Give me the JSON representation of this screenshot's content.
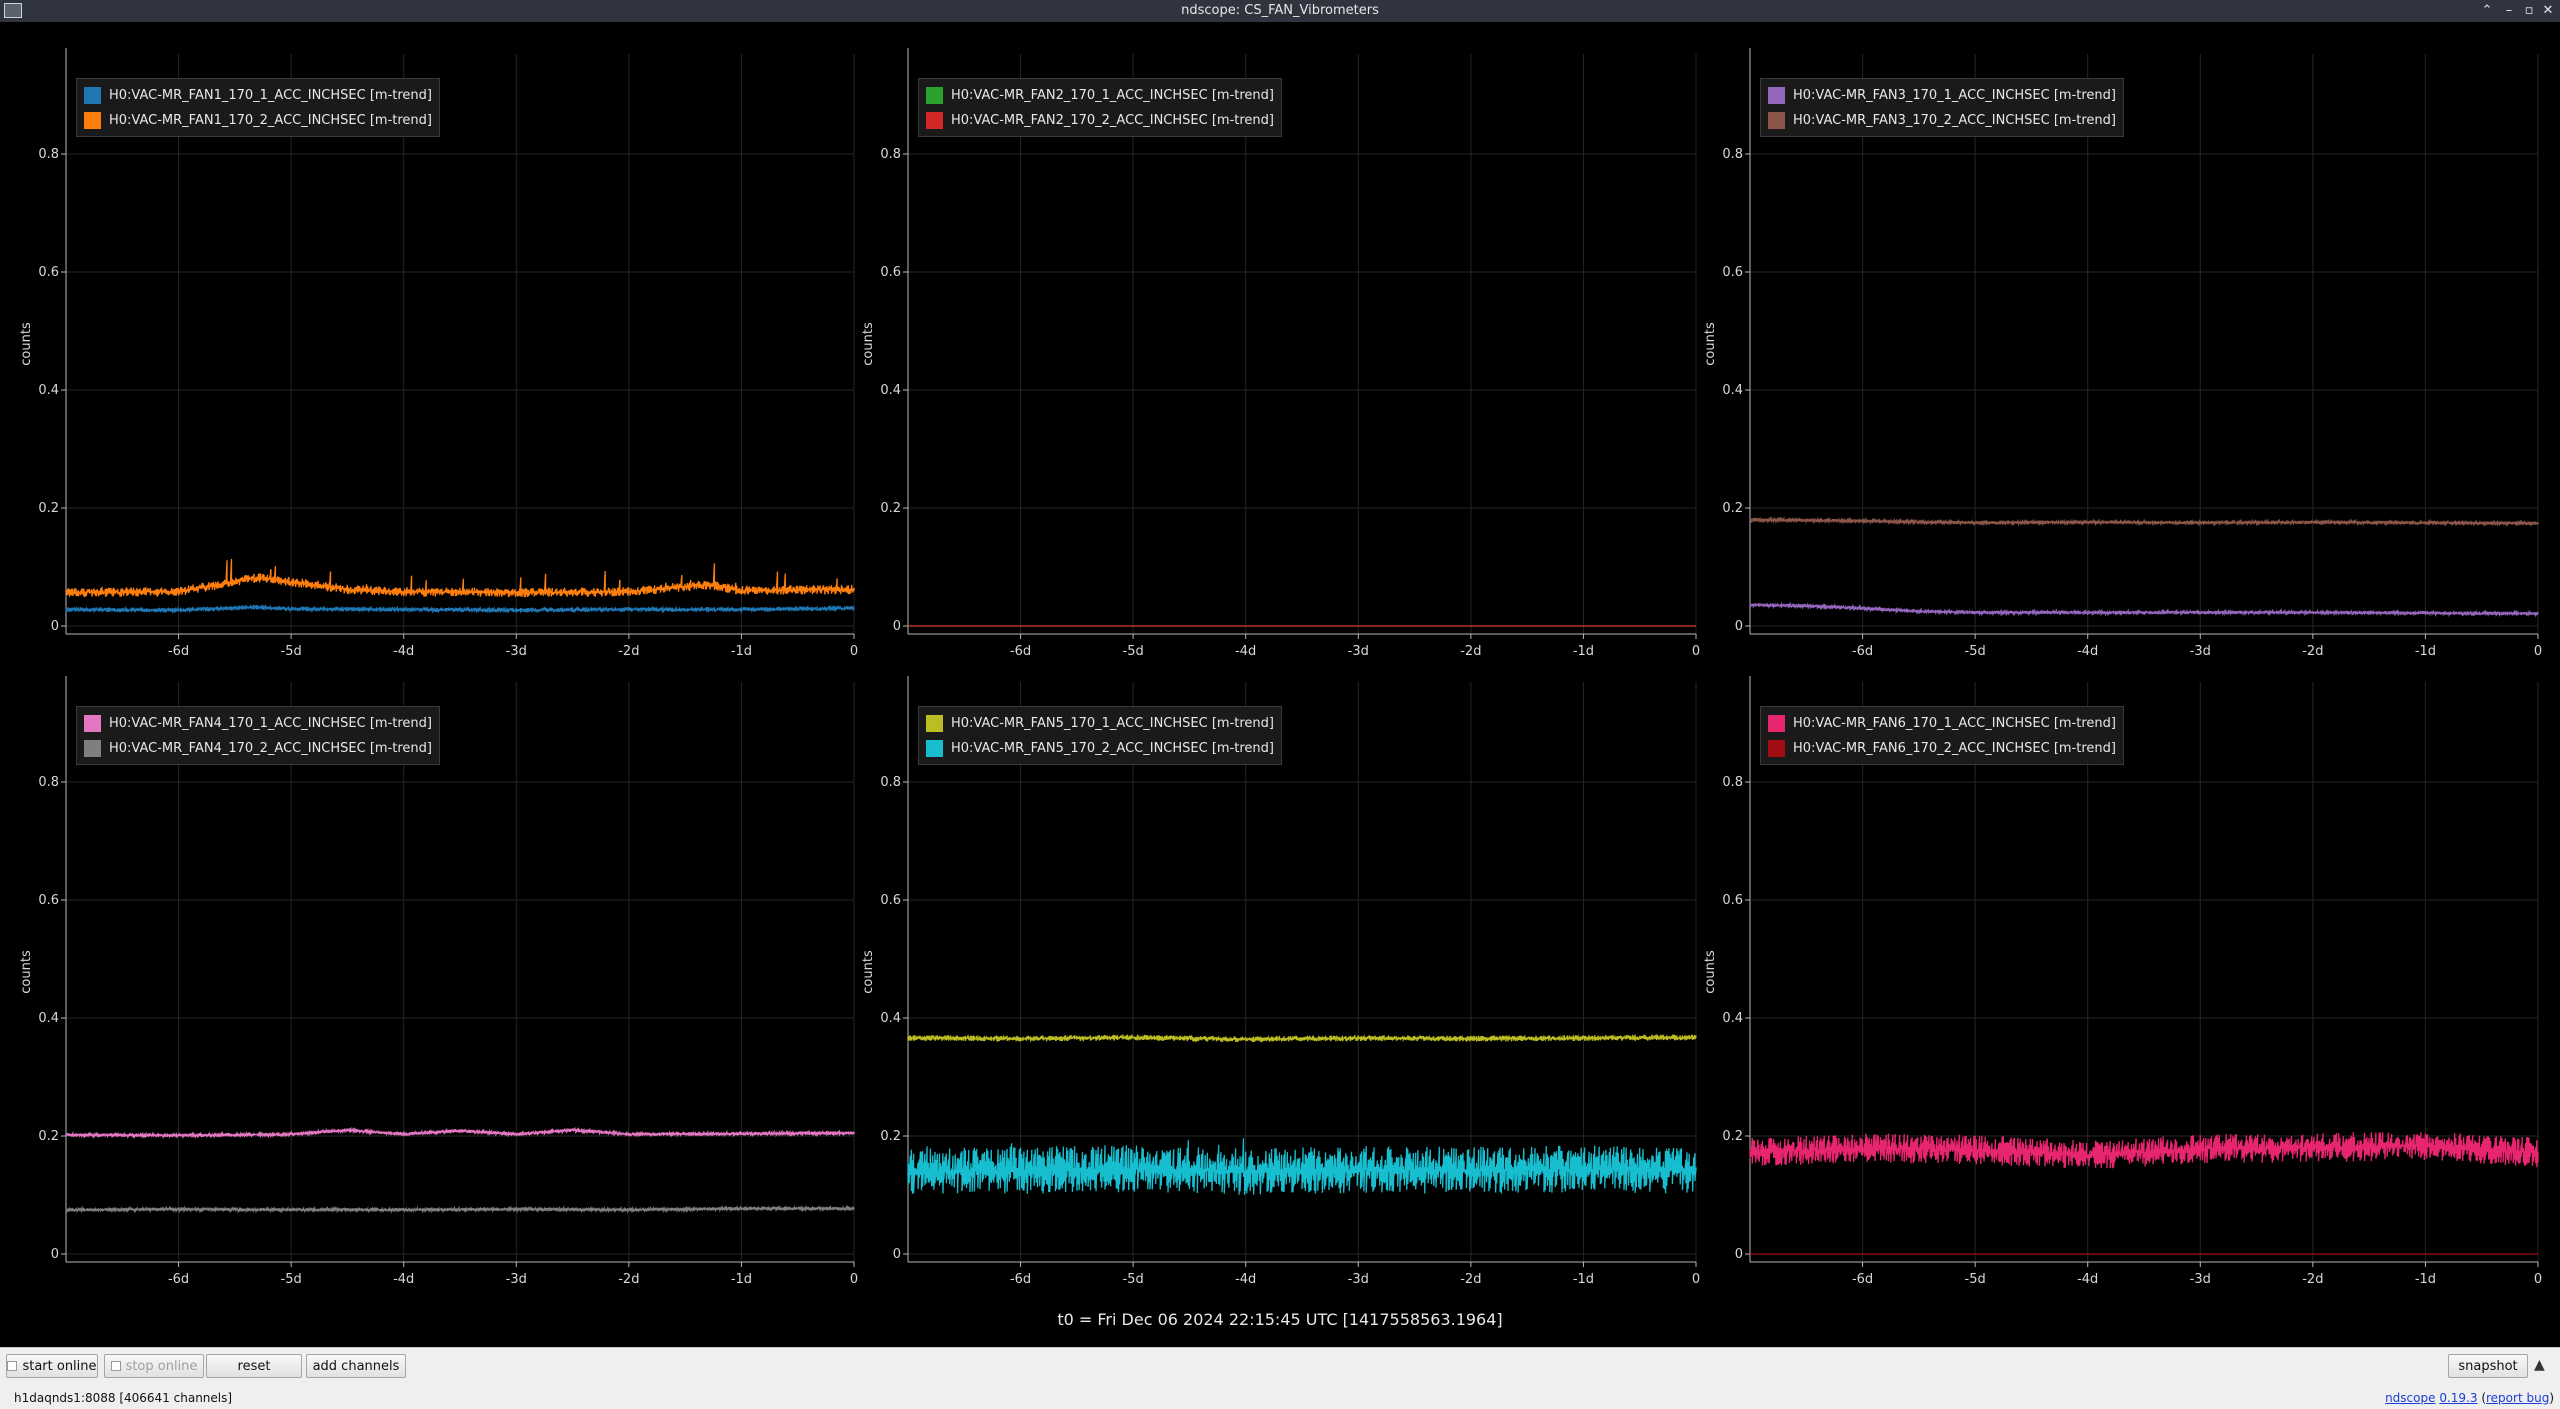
{
  "window": {
    "title": "ndscope: CS_FAN_Vibrometers",
    "controls": [
      "⌃",
      "–",
      "▫",
      "✕"
    ]
  },
  "plots": [
    {
      "id": "p1",
      "ylabel": "counts",
      "legend": [
        {
          "label": "H0:VAC-MR_FAN1_170_1_ACC_INCHSEC [m-trend]",
          "color": "#1f77b4"
        },
        {
          "label": "H0:VAC-MR_FAN1_170_2_ACC_INCHSEC [m-trend]",
          "color": "#ff7f0e"
        }
      ]
    },
    {
      "id": "p2",
      "ylabel": "counts",
      "legend": [
        {
          "label": "H0:VAC-MR_FAN2_170_1_ACC_INCHSEC [m-trend]",
          "color": "#2ca02c"
        },
        {
          "label": "H0:VAC-MR_FAN2_170_2_ACC_INCHSEC [m-trend]",
          "color": "#d62728"
        }
      ]
    },
    {
      "id": "p3",
      "ylabel": "counts",
      "legend": [
        {
          "label": "H0:VAC-MR_FAN3_170_1_ACC_INCHSEC [m-trend]",
          "color": "#9467bd"
        },
        {
          "label": "H0:VAC-MR_FAN3_170_2_ACC_INCHSEC [m-trend]",
          "color": "#8c564b"
        }
      ]
    },
    {
      "id": "p4",
      "ylabel": "counts",
      "legend": [
        {
          "label": "H0:VAC-MR_FAN4_170_1_ACC_INCHSEC [m-trend]",
          "color": "#e377c2"
        },
        {
          "label": "H0:VAC-MR_FAN4_170_2_ACC_INCHSEC [m-trend]",
          "color": "#7f7f7f"
        }
      ]
    },
    {
      "id": "p5",
      "ylabel": "counts",
      "legend": [
        {
          "label": "H0:VAC-MR_FAN5_170_1_ACC_INCHSEC [m-trend]",
          "color": "#bcbd22"
        },
        {
          "label": "H0:VAC-MR_FAN5_170_2_ACC_INCHSEC [m-trend]",
          "color": "#17becf"
        }
      ]
    },
    {
      "id": "p6",
      "ylabel": "counts",
      "legend": [
        {
          "label": "H0:VAC-MR_FAN6_170_1_ACC_INCHSEC [m-trend]",
          "color": "#e7266f"
        },
        {
          "label": "H0:VAC-MR_FAN6_170_2_ACC_INCHSEC [m-trend]",
          "color": "#a10d12"
        }
      ]
    }
  ],
  "chart_data": [
    {
      "type": "line",
      "ylabel": "counts",
      "ylim": [
        0,
        1
      ],
      "xlim": [
        -7,
        0
      ],
      "x_unit": "d",
      "xticks": [
        "-6d",
        "-5d",
        "-4d",
        "-3d",
        "-2d",
        "-1d",
        "0"
      ],
      "yticks": [
        "0",
        "0.2",
        "0.4",
        "0.6",
        "0.8"
      ],
      "grid": true,
      "legend_position": "top-left",
      "series": [
        {
          "name": "H0:VAC-MR_FAN1_170_1_ACC_INCHSEC [m-trend]",
          "color": "#1f77b4",
          "x": [
            -7,
            -6,
            -5.3,
            -5,
            -4,
            -3,
            -2,
            -1,
            0
          ],
          "y": [
            0.028,
            0.027,
            0.032,
            0.029,
            0.028,
            0.027,
            0.028,
            0.028,
            0.03
          ]
        },
        {
          "name": "H0:VAC-MR_FAN1_170_2_ACC_INCHSEC [m-trend]",
          "color": "#ff7f0e",
          "x": [
            -7,
            -6,
            -5.3,
            -5,
            -4.5,
            -4,
            -3,
            -2,
            -1.3,
            -1,
            0
          ],
          "y": [
            0.057,
            0.058,
            0.082,
            0.075,
            0.062,
            0.058,
            0.057,
            0.058,
            0.07,
            0.06,
            0.062
          ]
        }
      ]
    },
    {
      "type": "line",
      "ylabel": "counts",
      "ylim": [
        0,
        1
      ],
      "xlim": [
        -7,
        0
      ],
      "x_unit": "d",
      "xticks": [
        "-6d",
        "-5d",
        "-4d",
        "-3d",
        "-2d",
        "-1d",
        "0"
      ],
      "yticks": [
        "0",
        "0.2",
        "0.4",
        "0.6",
        "0.8"
      ],
      "grid": true,
      "legend_position": "top-left",
      "series": [
        {
          "name": "H0:VAC-MR_FAN2_170_1_ACC_INCHSEC [m-trend]",
          "color": "#2ca02c",
          "x": [
            -7,
            0
          ],
          "y": [
            0,
            0
          ]
        },
        {
          "name": "H0:VAC-MR_FAN2_170_2_ACC_INCHSEC [m-trend]",
          "color": "#d62728",
          "x": [
            -7,
            0
          ],
          "y": [
            0,
            0
          ]
        }
      ]
    },
    {
      "type": "line",
      "ylabel": "counts",
      "ylim": [
        0,
        1
      ],
      "xlim": [
        -7,
        0
      ],
      "x_unit": "d",
      "xticks": [
        "-6d",
        "-5d",
        "-4d",
        "-3d",
        "-2d",
        "-1d",
        "0"
      ],
      "yticks": [
        "0",
        "0.2",
        "0.4",
        "0.6",
        "0.8"
      ],
      "grid": true,
      "legend_position": "top-left",
      "series": [
        {
          "name": "H0:VAC-MR_FAN3_170_1_ACC_INCHSEC [m-trend]",
          "color": "#9467bd",
          "x": [
            -7,
            -6.5,
            -6,
            -5.5,
            -5,
            -4,
            -3,
            -2,
            -1,
            0
          ],
          "y": [
            0.036,
            0.034,
            0.03,
            0.025,
            0.023,
            0.023,
            0.023,
            0.023,
            0.022,
            0.021
          ]
        },
        {
          "name": "H0:VAC-MR_FAN3_170_2_ACC_INCHSEC [m-trend]",
          "color": "#8c564b",
          "x": [
            -7,
            -6,
            -5,
            -4,
            -3,
            -2,
            -1,
            0
          ],
          "y": [
            0.18,
            0.178,
            0.175,
            0.176,
            0.175,
            0.176,
            0.175,
            0.174
          ]
        }
      ]
    },
    {
      "type": "line",
      "ylabel": "counts",
      "ylim": [
        0,
        1
      ],
      "xlim": [
        -7,
        0
      ],
      "x_unit": "d",
      "xticks": [
        "-6d",
        "-5d",
        "-4d",
        "-3d",
        "-2d",
        "-1d",
        "0"
      ],
      "yticks": [
        "0",
        "0.2",
        "0.4",
        "0.6",
        "0.8"
      ],
      "grid": true,
      "legend_position": "top-left",
      "series": [
        {
          "name": "H0:VAC-MR_FAN4_170_1_ACC_INCHSEC [m-trend]",
          "color": "#e377c2",
          "x": [
            -7,
            -6,
            -5,
            -4.5,
            -4,
            -3.5,
            -3,
            -2.5,
            -2,
            -1,
            0
          ],
          "y": [
            0.202,
            0.201,
            0.203,
            0.21,
            0.203,
            0.209,
            0.203,
            0.21,
            0.203,
            0.204,
            0.205
          ]
        },
        {
          "name": "H0:VAC-MR_FAN4_170_2_ACC_INCHSEC [m-trend]",
          "color": "#7f7f7f",
          "x": [
            -7,
            -6,
            -5,
            -4,
            -3,
            -2,
            -1,
            0
          ],
          "y": [
            0.075,
            0.076,
            0.075,
            0.075,
            0.076,
            0.075,
            0.077,
            0.077
          ]
        }
      ]
    },
    {
      "type": "line",
      "ylabel": "counts",
      "ylim": [
        0,
        1
      ],
      "xlim": [
        -7,
        0
      ],
      "x_unit": "d",
      "xticks": [
        "-6d",
        "-5d",
        "-4d",
        "-3d",
        "-2d",
        "-1d",
        "0"
      ],
      "yticks": [
        "0",
        "0.2",
        "0.4",
        "0.6",
        "0.8"
      ],
      "grid": true,
      "legend_position": "top-left",
      "series": [
        {
          "name": "H0:VAC-MR_FAN5_170_1_ACC_INCHSEC [m-trend]",
          "color": "#bcbd22",
          "x": [
            -7,
            -6,
            -5,
            -4,
            -3,
            -2,
            -1,
            0
          ],
          "y": [
            0.366,
            0.365,
            0.367,
            0.364,
            0.366,
            0.365,
            0.366,
            0.367
          ]
        },
        {
          "name": "H0:VAC-MR_FAN5_170_2_ACC_INCHSEC [m-trend]",
          "color": "#17becf",
          "x": [
            -7,
            -6,
            -5,
            -4,
            -3,
            -2,
            -1,
            0
          ],
          "y": [
            0.14,
            0.142,
            0.145,
            0.14,
            0.143,
            0.142,
            0.144,
            0.141
          ]
        }
      ]
    },
    {
      "type": "line",
      "ylabel": "counts",
      "ylim": [
        0,
        1
      ],
      "xlim": [
        -7,
        0
      ],
      "x_unit": "d",
      "xticks": [
        "-6d",
        "-5d",
        "-4d",
        "-3d",
        "-2d",
        "-1d",
        "0"
      ],
      "yticks": [
        "0",
        "0.2",
        "0.4",
        "0.6",
        "0.8"
      ],
      "grid": true,
      "legend_position": "top-left",
      "series": [
        {
          "name": "H0:VAC-MR_FAN6_170_1_ACC_INCHSEC [m-trend]",
          "color": "#e7266f",
          "x": [
            -7,
            -6,
            -5,
            -4,
            -3,
            -2,
            -1,
            0
          ],
          "y": [
            0.172,
            0.18,
            0.177,
            0.168,
            0.178,
            0.18,
            0.184,
            0.172
          ]
        },
        {
          "name": "H0:VAC-MR_FAN6_170_2_ACC_INCHSEC [m-trend]",
          "color": "#a10d12",
          "x": [
            -7,
            0
          ],
          "y": [
            0,
            0
          ]
        }
      ]
    }
  ],
  "t0_label": "t0 = Fri Dec 06 2024 22:15:45 UTC [1417558563.1964]",
  "toolbar": {
    "start_online": "start online",
    "stop_online": "stop online",
    "reset": "reset",
    "add_channels": "add channels",
    "snapshot": "snapshot",
    "expand_icon": "▲"
  },
  "status": {
    "server": "h1daqnds1:8088  [406641 channels]",
    "app_link": "ndscope",
    "version": "0.19.3",
    "report_bug": "report bug"
  }
}
